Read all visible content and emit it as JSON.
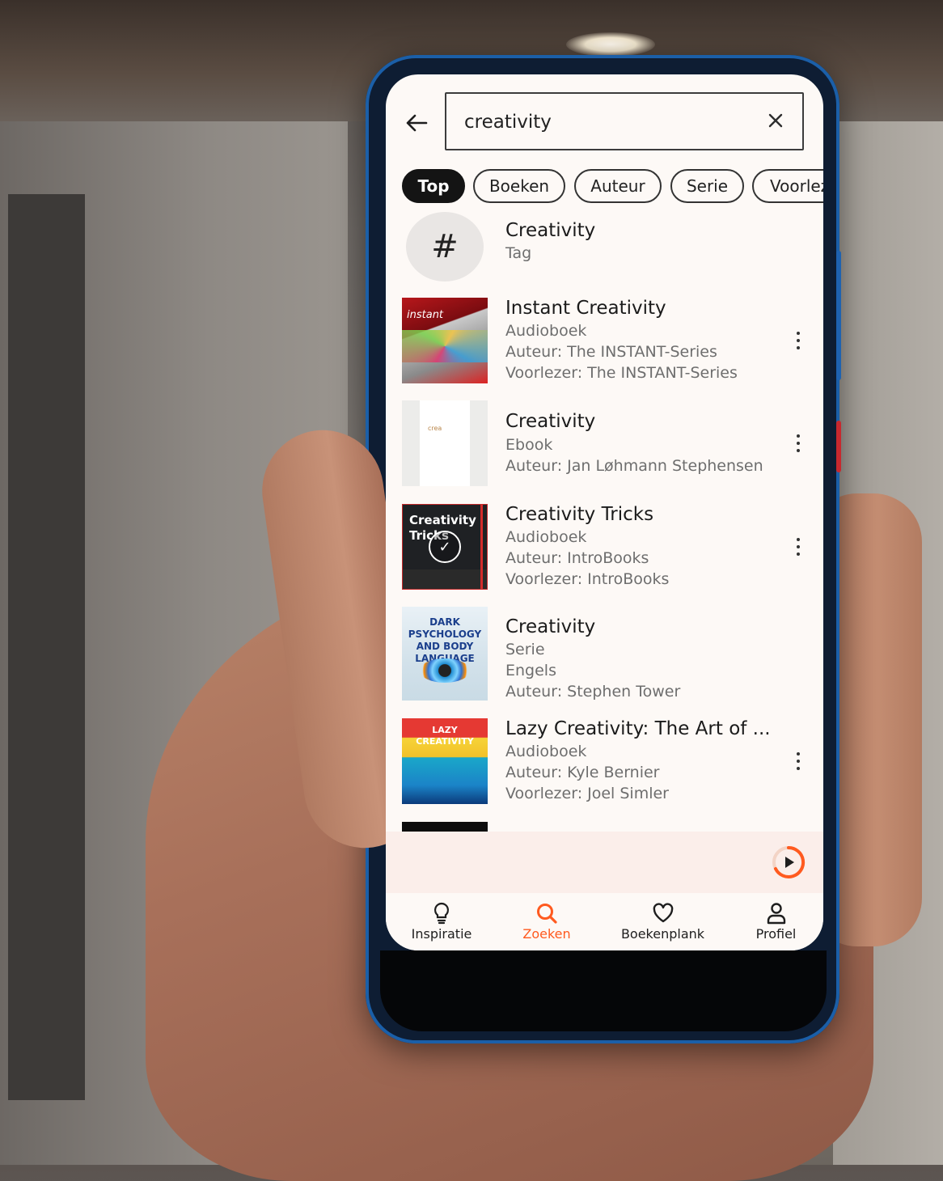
{
  "search": {
    "query": "creativity",
    "back_icon": "arrow-left-icon",
    "clear_icon": "close-icon"
  },
  "filters": [
    {
      "label": "Top",
      "active": true
    },
    {
      "label": "Boeken",
      "active": false
    },
    {
      "label": "Auteur",
      "active": false
    },
    {
      "label": "Serie",
      "active": false
    },
    {
      "label": "Voorlez",
      "active": false
    }
  ],
  "results": [
    {
      "title": "Creativity",
      "lines": [
        "Tag"
      ],
      "icon": "hashtag-icon"
    },
    {
      "title": "Instant Creativity",
      "lines": [
        "Audioboek",
        "Auteur: The INSTANT-Series",
        "Voorlezer: The INSTANT-Series"
      ],
      "cover_text": "instant"
    },
    {
      "title": "Creativity",
      "lines": [
        "Ebook",
        "Auteur: Jan Løhmann Stephensen"
      ],
      "cover_text": "crea"
    },
    {
      "title": "Creativity Tricks",
      "lines": [
        "Audioboek",
        "Auteur: IntroBooks",
        "Voorlezer: IntroBooks"
      ],
      "cover_text": "Creativity Tricks"
    },
    {
      "title": "Creativity",
      "lines": [
        "Serie",
        "Engels",
        "Auteur: Stephen Tower"
      ],
      "cover_text": "DARK PSYCHOLOGY AND BODY LANGUAGE"
    },
    {
      "title": "Lazy Creativity: The Art of ...",
      "lines": [
        "Audioboek",
        "Auteur: Kyle Bernier",
        "Voorlezer: Joel Simler"
      ],
      "cover_text": "LAZY CREATIVITY"
    }
  ],
  "player": {
    "icon": "play-icon"
  },
  "nav": [
    {
      "label": "Inspiratie",
      "icon": "lightbulb-icon",
      "active": false
    },
    {
      "label": "Zoeken",
      "icon": "search-icon",
      "active": true
    },
    {
      "label": "Boekenplank",
      "icon": "heart-icon",
      "active": false
    },
    {
      "label": "Profiel",
      "icon": "person-icon",
      "active": false
    }
  ],
  "colors": {
    "accent": "#ff5a1f",
    "chip_active": "#141414",
    "background": "#fdf9f6"
  }
}
